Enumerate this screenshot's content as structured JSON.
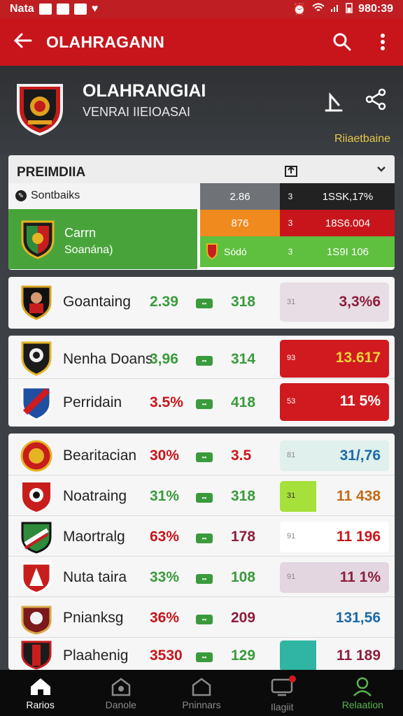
{
  "status": {
    "left_text": "Nata",
    "time": "980:39"
  },
  "appbar": {
    "title": "OLAHRAGANN"
  },
  "header": {
    "title": "OLAHRANGIAI",
    "subtitle": "VENRAI IIEIOASAI",
    "link": "Riiaetbaine"
  },
  "panel": {
    "title": "PREIMDIIA",
    "sub_label": "Sontbaiks",
    "team_name": "Carrn",
    "team_sub": "Soanána)",
    "rows": [
      {
        "mid": "2.86",
        "num": "3",
        "val": "1SSK,17%"
      },
      {
        "mid": "876",
        "num": "3",
        "val": "18S6.004"
      },
      {
        "mid": "Sódó",
        "num": "3",
        "val": "1S9I 106"
      }
    ]
  },
  "card1": [
    {
      "name": "Goantaing",
      "v1": "2.39",
      "v2": "318",
      "num": "31",
      "val": "3,3%6"
    }
  ],
  "card2": [
    {
      "name": "Nenha Doans",
      "v1": "3,96",
      "v2": "314",
      "num": "93",
      "val": "13.617"
    },
    {
      "name": "Perridain",
      "v1": "3.5%",
      "v2": "418",
      "num": "53",
      "val": "11  5%"
    }
  ],
  "card3": [
    {
      "name": "Bearitacian",
      "v1": "30%",
      "v2": "3.5",
      "num": "81",
      "val": "31/,76"
    },
    {
      "name": "Noatraing",
      "v1": "31%",
      "v2": "318",
      "num": "31",
      "val": "11  438"
    },
    {
      "name": "Maortralg",
      "v1": "63%",
      "v2": "178",
      "num": "91",
      "val": "11  196"
    },
    {
      "name": "Nuta taira",
      "v1": "33%",
      "v2": "108",
      "num": "91",
      "val": "11  1%"
    },
    {
      "name": "Pnianksg",
      "v1": "36%",
      "v2": "209",
      "num": "",
      "val": "131,56"
    },
    {
      "name": "Plaahenig",
      "v1": "3530",
      "v2": "129",
      "num": "",
      "val": "11  189"
    }
  ],
  "nav": [
    "Rarios",
    "Danole",
    "Pninnars",
    "Ilagiit",
    "Relaation"
  ]
}
